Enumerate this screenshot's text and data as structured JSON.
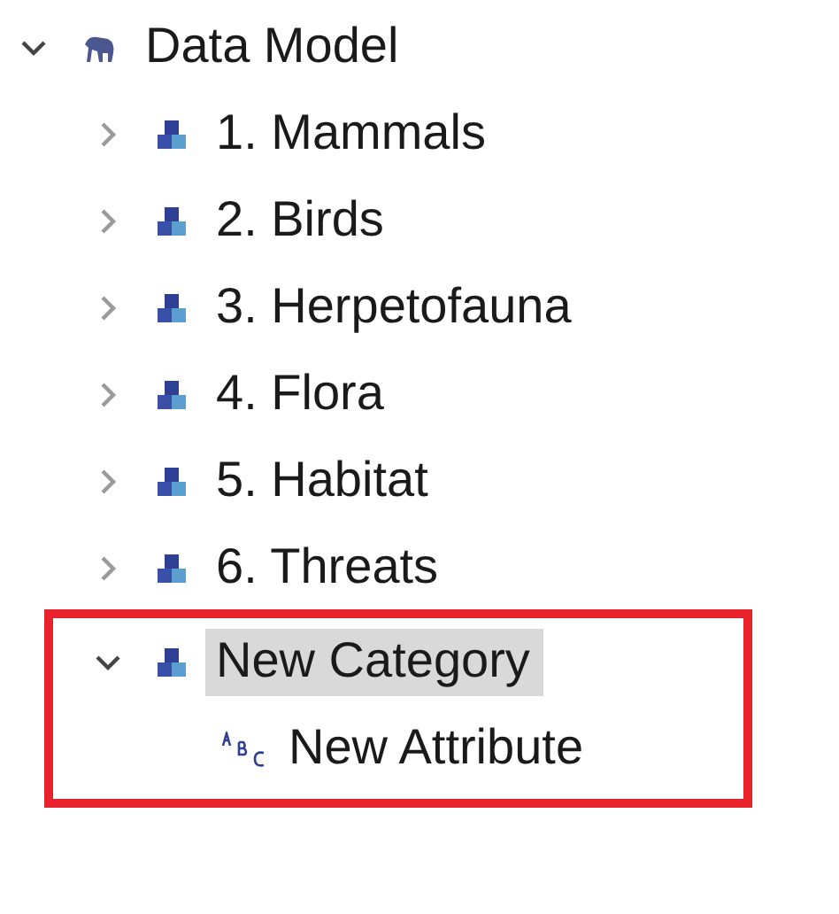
{
  "tree": [
    {
      "label": "Data Model",
      "kind": "model",
      "expanded": true,
      "selected": false,
      "children": [
        {
          "label": "1. Mammals",
          "kind": "category",
          "expanded": false,
          "selected": false
        },
        {
          "label": "2. Birds",
          "kind": "category",
          "expanded": false,
          "selected": false
        },
        {
          "label": "3. Herpetofauna",
          "kind": "category",
          "expanded": false,
          "selected": false
        },
        {
          "label": "4. Flora",
          "kind": "category",
          "expanded": false,
          "selected": false
        },
        {
          "label": "5. Habitat",
          "kind": "category",
          "expanded": false,
          "selected": false
        },
        {
          "label": "6. Threats",
          "kind": "category",
          "expanded": false,
          "selected": false
        },
        {
          "label": "New Category",
          "kind": "category",
          "expanded": true,
          "selected": true,
          "annotated": true,
          "children": [
            {
              "label": "New Attribute",
              "kind": "attribute",
              "selected": false
            }
          ]
        }
      ]
    }
  ]
}
